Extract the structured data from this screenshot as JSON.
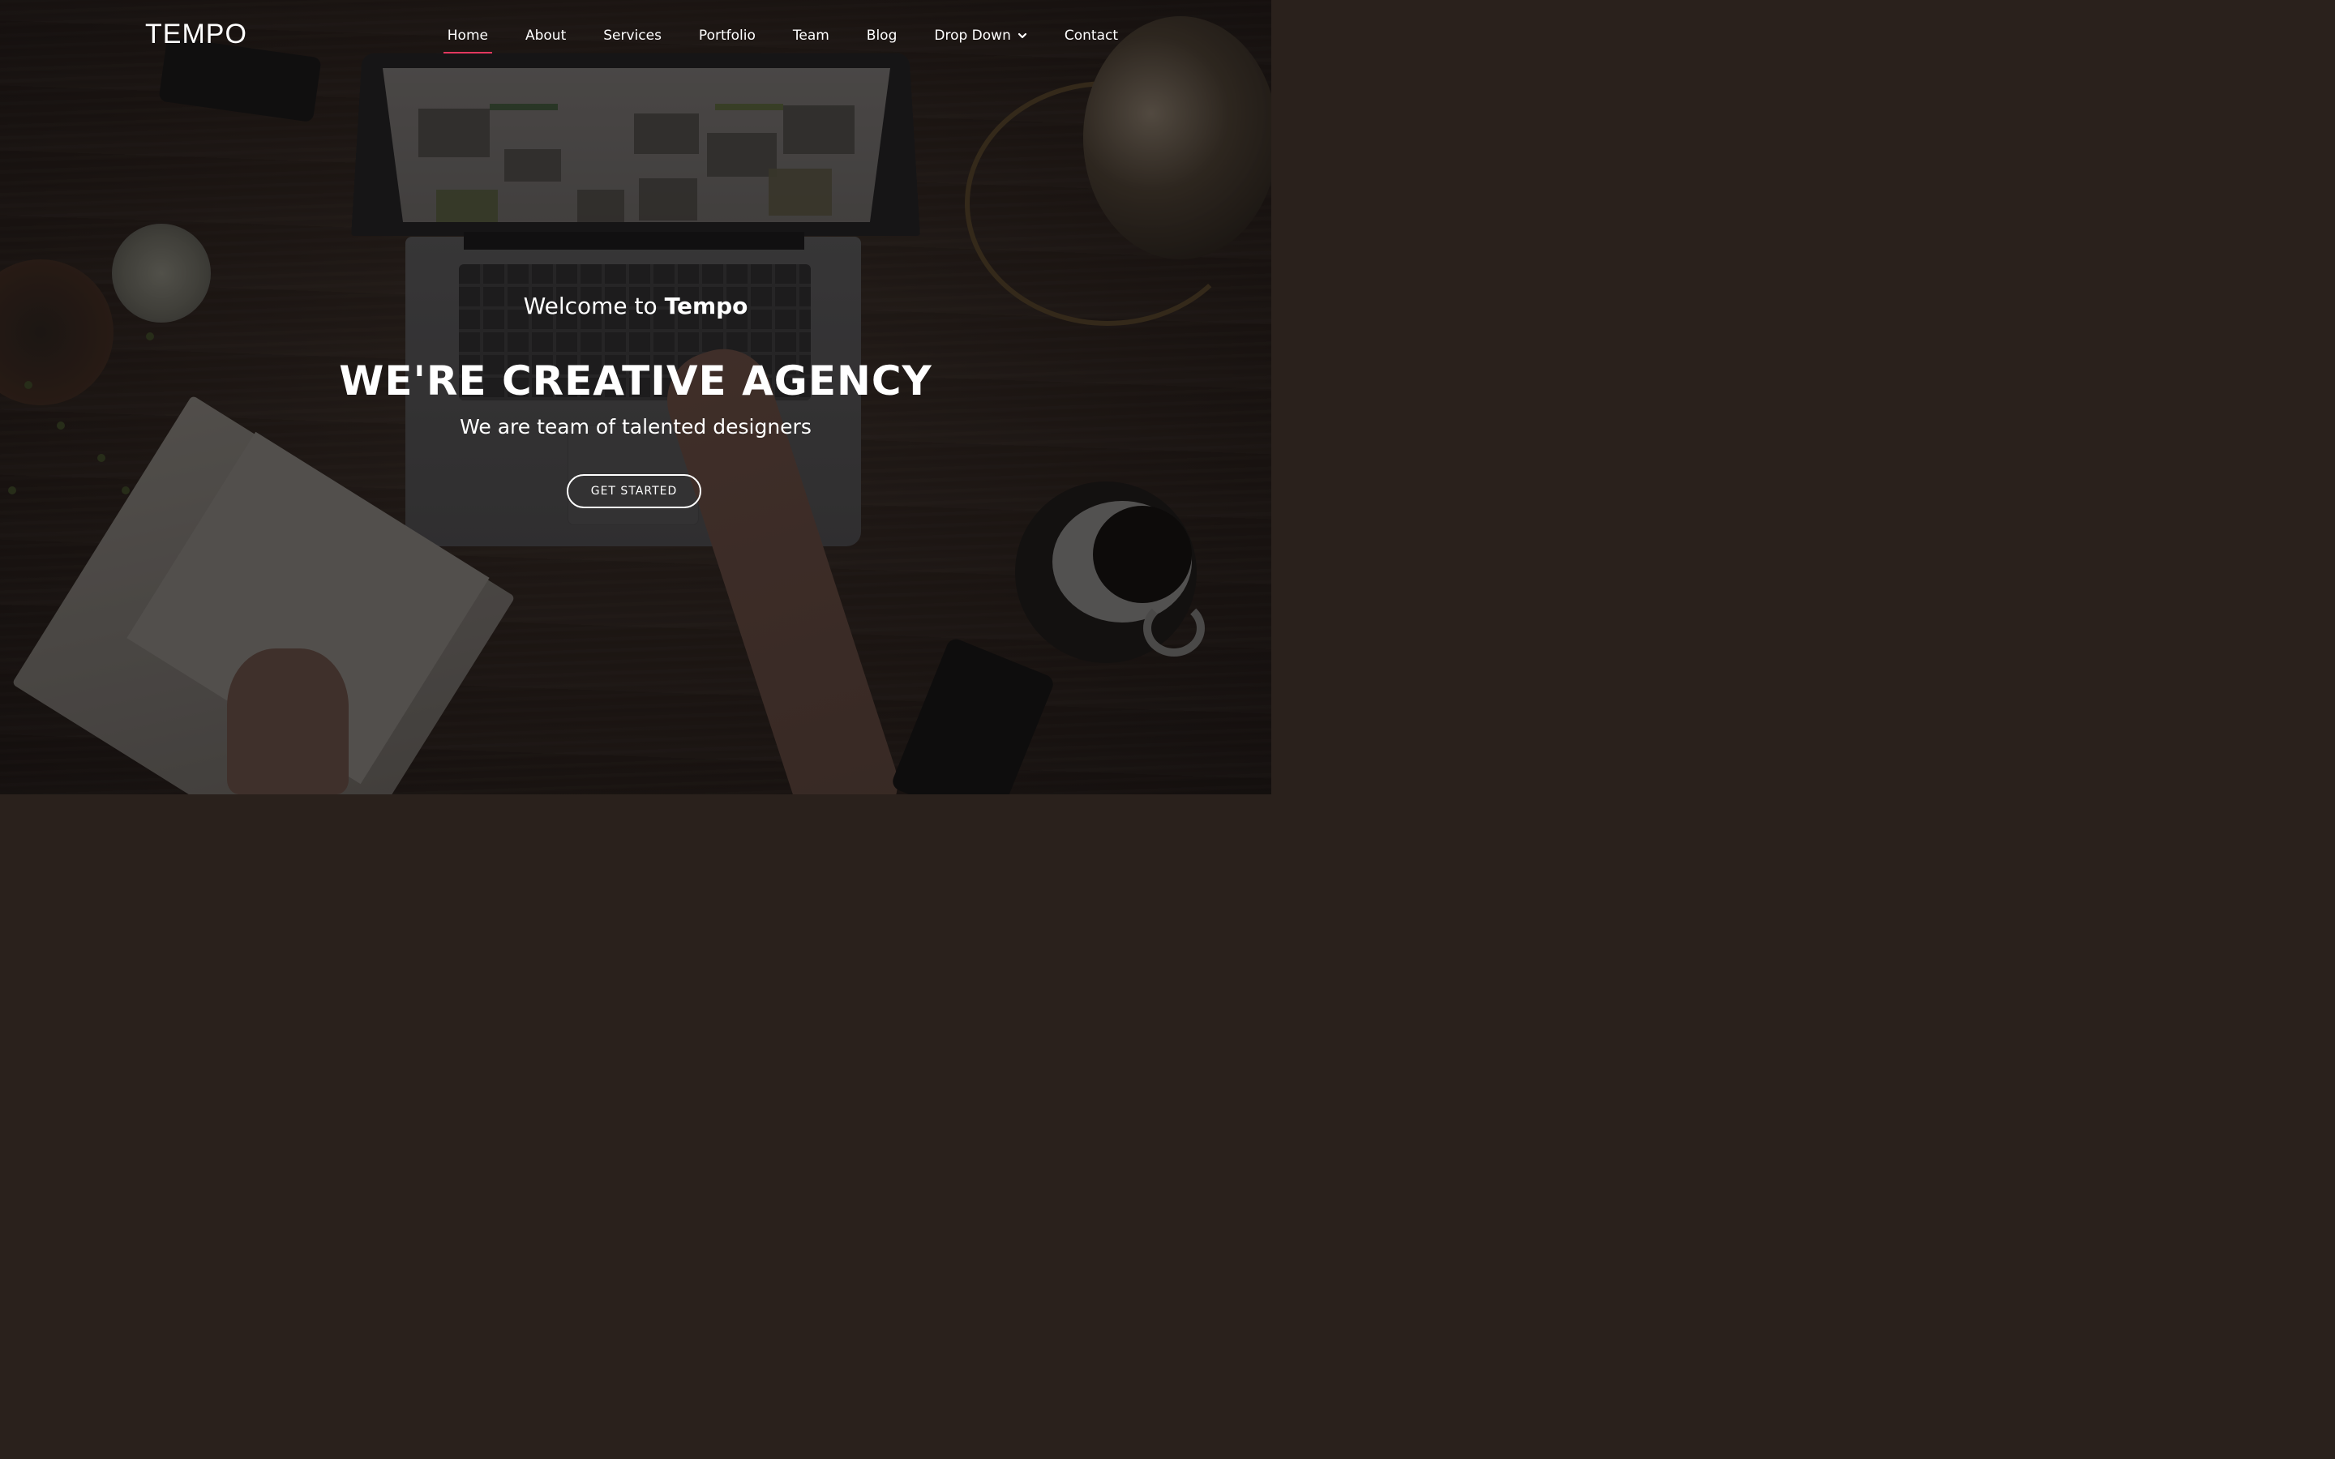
{
  "header": {
    "logo": "TEMPO",
    "nav": [
      {
        "label": "Home",
        "active": true
      },
      {
        "label": "About"
      },
      {
        "label": "Services"
      },
      {
        "label": "Portfolio"
      },
      {
        "label": "Team"
      },
      {
        "label": "Blog"
      },
      {
        "label": "Drop Down",
        "icon": "chevron-down-icon"
      },
      {
        "label": "Contact"
      }
    ],
    "accent_color": "#e2385f"
  },
  "hero": {
    "welcome_prefix": "Welcome to ",
    "welcome_brand": "Tempo",
    "headline": "WE'RE CREATIVE AGENCY",
    "tagline": "We are team of talented designers",
    "cta_label": "GET STARTED"
  }
}
